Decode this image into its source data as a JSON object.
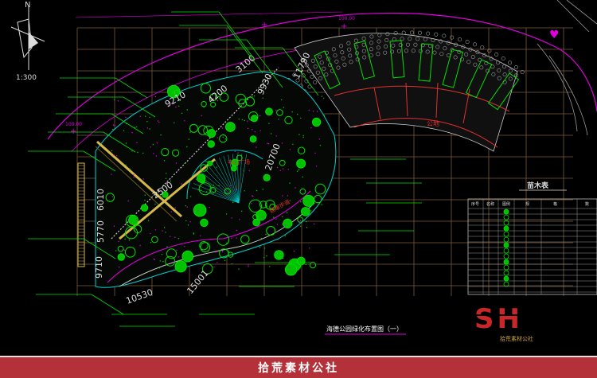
{
  "drawing": {
    "north_label": "N",
    "scale": "1:300",
    "title": "海德公园绿化布置图（一）",
    "plaza_label": "公地",
    "center_label": "中心广场",
    "path_label": "健康步道",
    "dimensions": [
      "3100",
      "11790",
      "9210",
      "4200",
      "9930",
      "20700",
      "6010",
      "5770",
      "9710",
      "10530",
      "15001",
      "2500"
    ]
  },
  "legend_table": {
    "title": "苗木表",
    "headers": [
      "序号",
      "名称",
      "图例",
      "规",
      "格",
      "数"
    ]
  },
  "watermark": {
    "logo": "SH",
    "text": "拾荒素材公社"
  },
  "footer": {
    "text": "拾荒素材公社"
  },
  "colors": {
    "grid": "#7a5a3a",
    "tree_green": "#00e000",
    "cad_cyan": "#00d0d0",
    "cad_magenta": "#e000e0",
    "cad_red": "#e03030",
    "hatch_white": "#c8c8c8",
    "footer_red": "#b5313a"
  }
}
